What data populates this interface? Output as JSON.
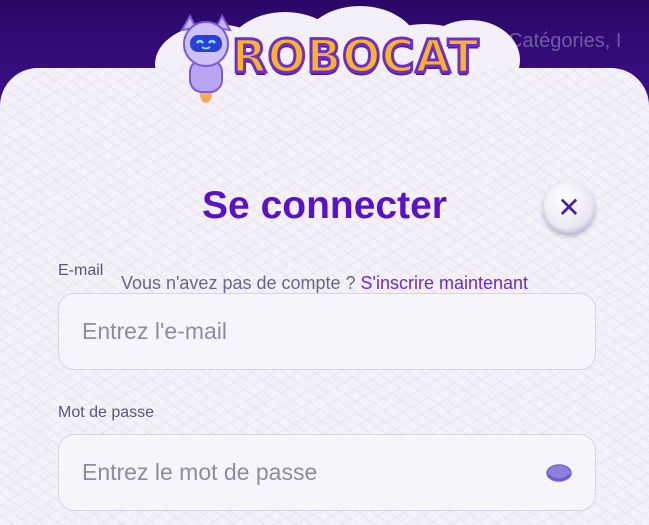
{
  "header": {
    "nav_partial": "Catégories, I"
  },
  "logo": {
    "text": "ROBOCAT",
    "mascot_icon": "robot-cat-mascot-icon"
  },
  "modal": {
    "title": "Se connecter",
    "close_icon": "close-icon",
    "close_glyph": "✕",
    "signup_prompt": "Vous n'avez pas de compte ?",
    "signup_link": "S'inscrire maintenant",
    "email": {
      "label": "E-mail",
      "value": "",
      "placeholder": "Entrez l'e-mail"
    },
    "password": {
      "label": "Mot de passe",
      "value": "",
      "placeholder": "Entrez le mot de passe",
      "toggle_icon": "eye-icon"
    }
  },
  "colors": {
    "header_bg": "#2c0a6b",
    "accent": "#5b10c9",
    "link": "#6a2ad0",
    "modal_bg": "#f4f2f8"
  }
}
